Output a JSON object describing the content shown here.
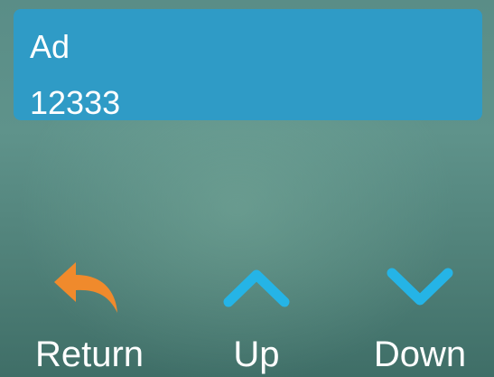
{
  "info": {
    "title": "Ad",
    "value": "12333"
  },
  "nav": {
    "return_label": "Return",
    "up_label": "Up",
    "down_label": "Down",
    "return_icon": "return-arrow-icon",
    "up_icon": "chevron-up-icon",
    "down_icon": "chevron-down-icon"
  },
  "colors": {
    "panel": "#2f9bc6",
    "return_icon": "#f08a2c",
    "chevron_icon": "#25b4e6",
    "text": "#ffffff"
  }
}
